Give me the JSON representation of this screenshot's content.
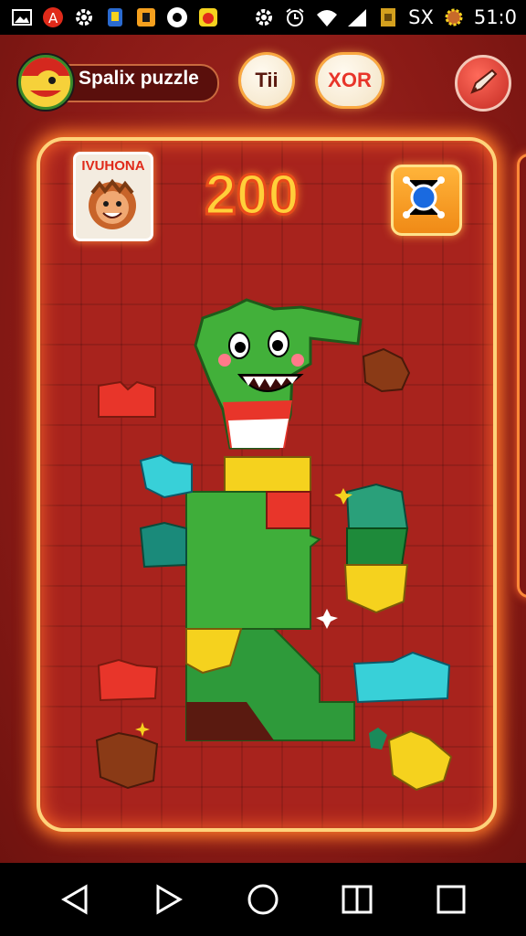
{
  "status_bar": {
    "carrier": "SX",
    "time": "51:0",
    "icons_left": [
      "gallery-icon",
      "app-a-icon",
      "settings-gear-icon",
      "app-bottle-icon",
      "app-square-icon",
      "app-circle-icon",
      "app-face-icon"
    ],
    "icons_right": [
      "gear-icon",
      "alarm-icon",
      "wifi-icon",
      "signal-icon",
      "sim-icon",
      "cog-icon"
    ]
  },
  "header": {
    "player_name": "Spalix puzzle",
    "button_left_label": "Tii",
    "button_right_label": "XOR",
    "tool_icon": "pen-icon"
  },
  "board": {
    "badge_label": "IVUHONA",
    "score": "200",
    "share_icon": "network-icon"
  },
  "colors": {
    "frame_glow": "#ff7a2a",
    "board_bg": "#a8231d",
    "score_fill": "#ffcf3a",
    "piece_green": "#3fae3a",
    "piece_yellow": "#f5d21e",
    "piece_cyan": "#38d0d8",
    "piece_red": "#e8352a",
    "piece_brown": "#8a3a16"
  },
  "navigation": {
    "icons": [
      "back-icon",
      "forward-icon",
      "home-icon",
      "split-icon",
      "recents-icon"
    ]
  }
}
